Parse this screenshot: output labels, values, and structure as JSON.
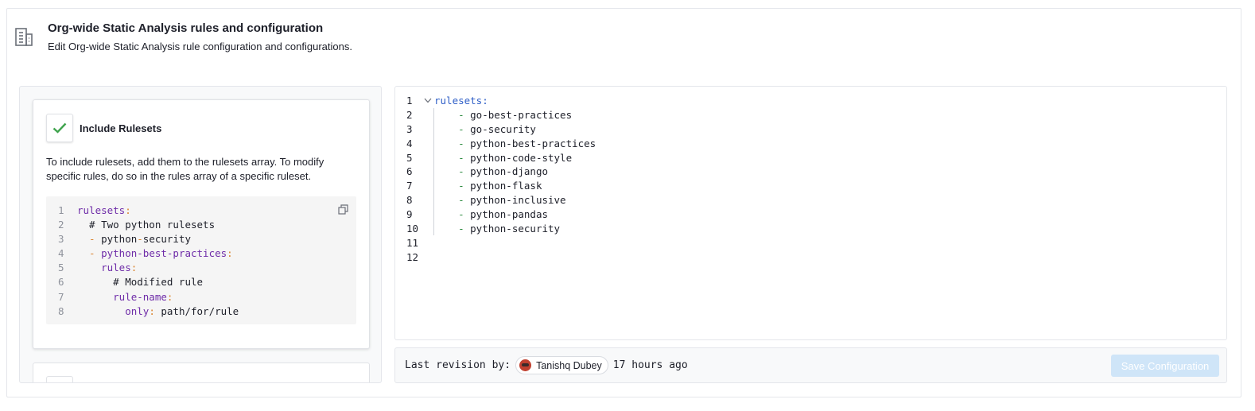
{
  "header": {
    "icon": "building-icon",
    "title": "Org-wide Static Analysis rules and configuration",
    "subtitle": "Edit Org-wide Static Analysis rule configuration and configurations."
  },
  "sidebar": {
    "include_card": {
      "icon": "check-icon",
      "title": "Include Rulesets",
      "description": "To include rulesets, add them to the rulesets array. To modify specific rules, do so in the rules array of a specific ruleset.",
      "snippet": [
        {
          "n": "1",
          "key": "rulesets",
          "punct": ":",
          "comment": "",
          "value": ""
        },
        {
          "n": "2",
          "comment": "  # Two python rulesets"
        },
        {
          "n": "3",
          "dash": "  - ",
          "value": "python",
          "punct2": "-",
          "value2": "security"
        },
        {
          "n": "4",
          "dash": "  - ",
          "key": "python-best-practices",
          "punct": ":"
        },
        {
          "n": "5",
          "key": "    rules",
          "punct": ":"
        },
        {
          "n": "6",
          "comment": "      # Modified rule"
        },
        {
          "n": "7",
          "key": "      rule-name",
          "punct": ":"
        },
        {
          "n": "8",
          "key": "        only",
          "punct": ":",
          "value": " path/for/rule"
        }
      ]
    },
    "exclude_card": {
      "icon": "error-icon"
    }
  },
  "editor": {
    "lines": [
      {
        "n": "1",
        "text": "rulesets:",
        "root": true,
        "fold": true
      },
      {
        "n": "2",
        "dash": "    - ",
        "text": "go-best-practices"
      },
      {
        "n": "3",
        "dash": "    - ",
        "text": "go-security"
      },
      {
        "n": "4",
        "dash": "    - ",
        "text": "python-best-practices"
      },
      {
        "n": "5",
        "dash": "    - ",
        "text": "python-code-style"
      },
      {
        "n": "6",
        "dash": "    - ",
        "text": "python-django"
      },
      {
        "n": "7",
        "dash": "    - ",
        "text": "python-flask"
      },
      {
        "n": "8",
        "dash": "    - ",
        "text": "python-inclusive"
      },
      {
        "n": "9",
        "dash": "    - ",
        "text": "python-pandas"
      },
      {
        "n": "10",
        "dash": "    - ",
        "text": "python-security"
      },
      {
        "n": "11",
        "text": ""
      },
      {
        "n": "12",
        "text": ""
      }
    ]
  },
  "footer": {
    "revision_label": "Last revision by:",
    "user_name": "Tanishq Dubey",
    "time_ago": "17 hours ago",
    "save_label": "Save Configuration"
  },
  "colors": {
    "accent_disabled": "#cfe5f8",
    "success": "#3fa34d",
    "yaml_key": "#6e2ca8",
    "yaml_punct": "#d9822b",
    "root_key": "#2f5fc7",
    "list_dash": "#2a8a3e"
  }
}
